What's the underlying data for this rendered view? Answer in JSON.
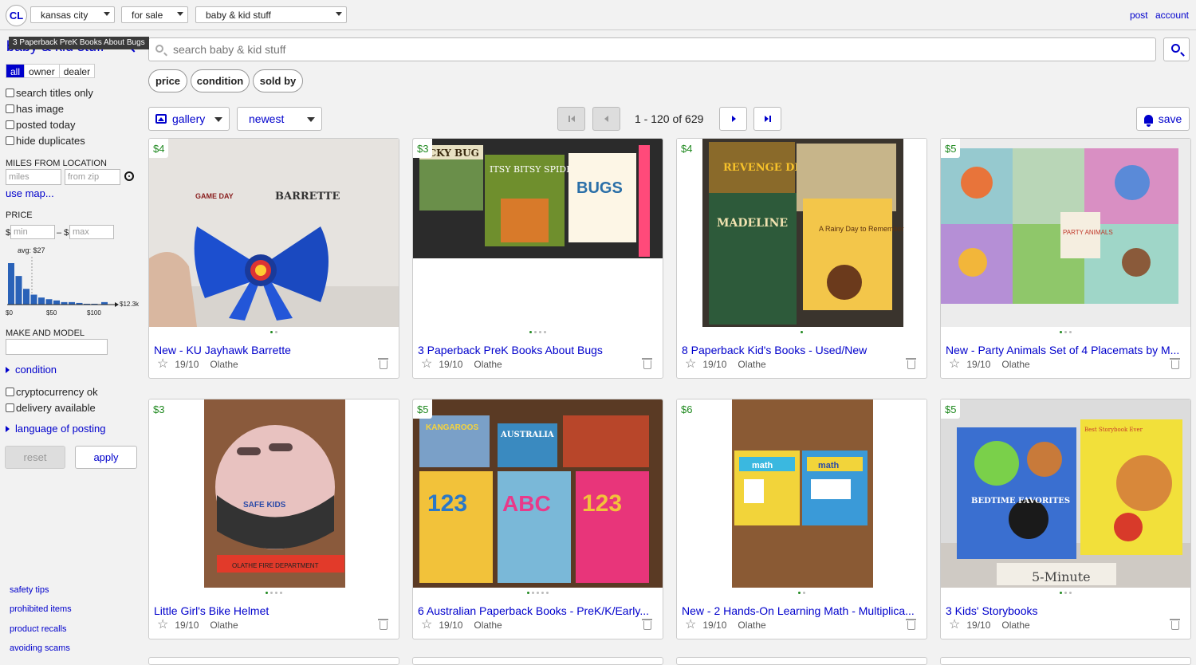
{
  "topbar": {
    "logo": "CL",
    "location": "kansas city",
    "category_type": "for sale",
    "category": "baby & kid stuff",
    "post_link": "post",
    "account_link": "account"
  },
  "tooltip": "3 Paperback PreK Books About Bugs",
  "sidebar": {
    "title": "baby & kid stuff",
    "seller_filter": [
      "all",
      "owner",
      "dealer"
    ],
    "checks": [
      "search titles only",
      "has image",
      "posted today",
      "hide duplicates"
    ],
    "miles_label": "MILES FROM LOCATION",
    "miles_placeholder": "miles",
    "zip_placeholder": "from zip",
    "use_map": "use map...",
    "price_label": "PRICE",
    "price_currency": "$",
    "price_dash": "– $",
    "min_placeholder": "min",
    "max_placeholder": "max",
    "histogram": {
      "avg_label": "avg: $27",
      "right_label": "$12.3k",
      "ticks": [
        "$0",
        "$50",
        "$100"
      ],
      "bar_levels": [
        1.0,
        0.69,
        0.38,
        0.24,
        0.17,
        0.13,
        0.1,
        0.06,
        0.06,
        0.04,
        0.02,
        0.02,
        0.06
      ]
    },
    "make_model_label": "MAKE AND MODEL",
    "condition_link": "condition",
    "checks2": [
      "cryptocurrency ok",
      "delivery available"
    ],
    "language_link": "language of posting",
    "reset_label": "reset",
    "apply_label": "apply",
    "footer_links": [
      "safety tips",
      "prohibited items",
      "product recalls",
      "avoiding scams"
    ]
  },
  "search": {
    "placeholder": "search baby & kid stuff"
  },
  "pills": [
    "price",
    "condition",
    "sold by"
  ],
  "toolbar": {
    "view": "gallery",
    "sort": "newest",
    "count": "1 - 120 of 629",
    "save": "save"
  },
  "listings": [
    {
      "price": "$4",
      "title": "New - KU Jayhawk Barrette",
      "date": "19/10",
      "location": "Olathe",
      "dots": 2,
      "active": 0
    },
    {
      "price": "$3",
      "title": "3 Paperback PreK Books About Bugs",
      "date": "19/10",
      "location": "Olathe",
      "dots": 4,
      "active": 0
    },
    {
      "price": "$4",
      "title": "8 Paperback Kid's Books - Used/New",
      "date": "19/10",
      "location": "Olathe",
      "dots": 1,
      "active": 0
    },
    {
      "price": "$5",
      "title": "New - Party Animals Set of 4 Placemats by M...",
      "date": "19/10",
      "location": "Olathe",
      "dots": 3,
      "active": 0
    },
    {
      "price": "$3",
      "title": "Little Girl's Bike Helmet",
      "date": "19/10",
      "location": "Olathe",
      "dots": 4,
      "active": 0
    },
    {
      "price": "$5",
      "title": "6 Australian Paperback Books - PreK/K/Early...",
      "date": "19/10",
      "location": "Olathe",
      "dots": 5,
      "active": 0
    },
    {
      "price": "$6",
      "title": "New - 2 Hands-On Learning Math - Multiplica...",
      "date": "19/10",
      "location": "Olathe",
      "dots": 2,
      "active": 0
    },
    {
      "price": "$5",
      "title": "3 Kids' Storybooks",
      "date": "19/10",
      "location": "Olathe",
      "dots": 3,
      "active": 0
    }
  ],
  "image_text": {
    "barrette_tag": "BARRETTE",
    "barrette_brand": "GAME DAY",
    "bug_book_1": "ICKY BUG",
    "bug_book_2": "ITSY BITSY SPIDER",
    "bug_book_3": "BUGS",
    "book_a": "REVENGE DINOTRUX",
    "book_b": "MADELINE",
    "book_c": "A Rainy Day to Remember",
    "placemat_label": "PARTY ANIMALS",
    "helmet_label": "SAFE KIDS",
    "ruler_label": "OLATHE FIRE DEPARTMENT",
    "aus_1": "KANGAROOS",
    "aus_2": "AUSTRALIA",
    "aus_3": "123",
    "aus_4": "ABC",
    "aus_5": "123",
    "math_1": "math",
    "math_2": "math",
    "story_1": "BEDTIME FAVORITES",
    "story_2": "5-Minute",
    "story_3": "Best Storybook Ever"
  }
}
